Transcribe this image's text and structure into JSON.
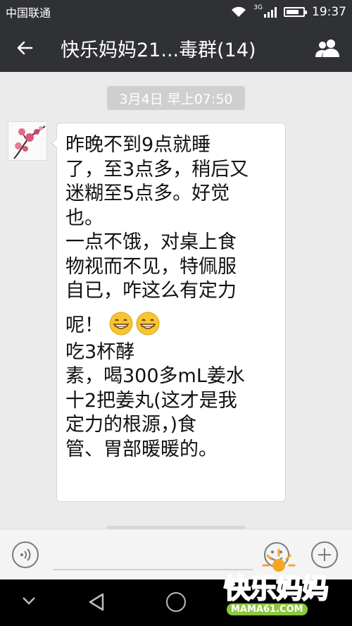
{
  "status_bar": {
    "carrier": "中国联通",
    "network": "3G",
    "time": "19:37",
    "battery_level": 0.75
  },
  "header": {
    "title": "快乐妈妈21...毒群(14)",
    "back_icon": "back-arrow-icon",
    "group_icon": "group-members-icon"
  },
  "chat": {
    "date_label": "3月4日 早上07:50",
    "message": {
      "avatar_icon": "plum-blossom-avatar",
      "lines_a": [
        "昨晚不到9点就睡",
        "了，至3点多，稍后又",
        "迷糊至5点多。好觉",
        "也。",
        "一点不饿，对桌上食",
        "物视而不见，特佩服",
        "自已，咋这么有定力"
      ],
      "emoji_line_text": "呢！",
      "emoji_count": 2,
      "lines_b": [
        "吃3杯酵",
        "素，喝300多mL姜水",
        "十2把姜丸(这才是我",
        "定力的根源，)食",
        "管、胃部暖暖的。"
      ]
    }
  },
  "input_bar": {
    "voice_icon": "voice-icon",
    "emoji_icon": "smiley-icon",
    "plus_icon": "plus-icon"
  },
  "nav_bar": {
    "down_icon": "chevron-down-icon",
    "back_icon": "triangle-back-icon",
    "home_icon": "circle-home-icon"
  },
  "watermark": {
    "brand": "快乐妈妈",
    "url": "MAMA61.COM"
  },
  "colors": {
    "bar_bg": "#2f3134",
    "chat_bg": "#ebebeb",
    "bubble_bg": "#ffffff",
    "watermark_green": "#8dc63f"
  }
}
